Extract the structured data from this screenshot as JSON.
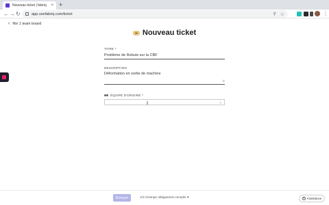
{
  "browser": {
    "tab_title": "Nouveau ticket | fabriq",
    "tab_close": "×",
    "new_tab": "+",
    "nav_back": "←",
    "nav_forward": "→",
    "nav_reload": "↻",
    "url": "app.usefabriq.com/ticket",
    "extension_colors": [
      "#21c1b6",
      "#2c2c2c",
      "#4a4a4a"
    ]
  },
  "page": {
    "back_link": "Niv 1 team board",
    "title": "Nouveau ticket",
    "fields": {
      "title": {
        "label": "TITRE *",
        "value": "Problème de Rebuts sur la CBF"
      },
      "description": {
        "label": "DESCRIPTION",
        "value": "Déformation en sortie de machine"
      },
      "origin_team": {
        "label": "ÉQUIPE D'ORIGINE *",
        "value": ""
      }
    }
  },
  "footer": {
    "submit_label": "Envoyer",
    "required_status": "1/3 champs obligatoires remplis",
    "assist_label": "Assistance",
    "assist_icon_glyph": "?"
  }
}
